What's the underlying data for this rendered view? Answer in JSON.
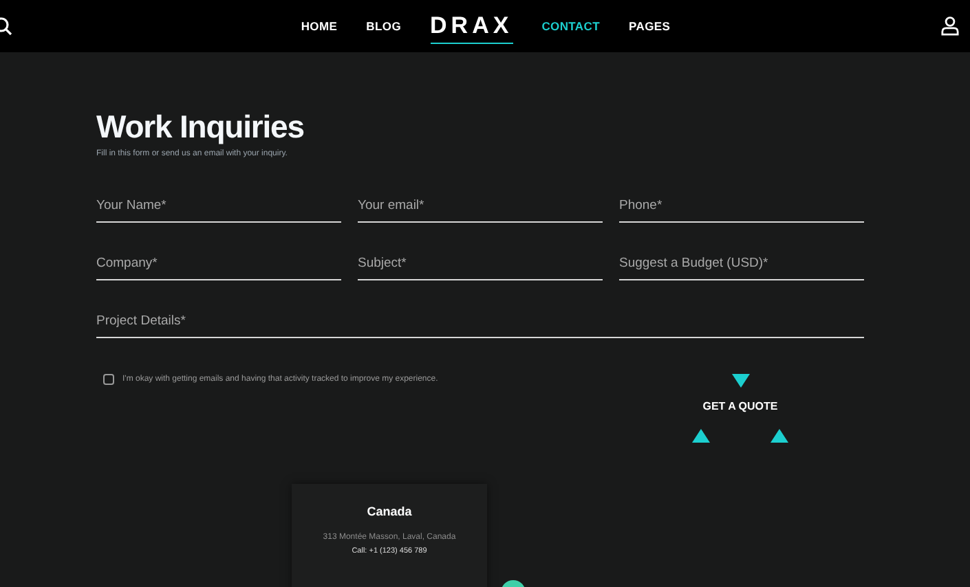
{
  "nav": {
    "left_items": [
      {
        "label": "HOME",
        "selected": false
      },
      {
        "label": "BLOG",
        "selected": false
      }
    ],
    "logo": "DRAX",
    "right_items": [
      {
        "label": "CONTACT",
        "selected": true
      },
      {
        "label": "PAGES",
        "selected": false
      }
    ]
  },
  "heading": "Work Inquiries",
  "subtitle": "Fill in this form or send us an email with your inquiry.",
  "fields": [
    {
      "placeholder": "Your Name*"
    },
    {
      "placeholder": "Your email*"
    },
    {
      "placeholder": "Phone*"
    },
    {
      "placeholder": "Company*"
    },
    {
      "placeholder": "Subject*"
    },
    {
      "placeholder": "Suggest a Budget (USD)*"
    }
  ],
  "details": {
    "placeholder": "Project Details*"
  },
  "consent": {
    "label": "I'm okay with getting emails and having that activity tracked to improve my experience.",
    "checked": false
  },
  "submit": "GET A QUOTE",
  "office": {
    "country": "Canada",
    "address": "313 Montée Masson, Laval, Canada",
    "phone": "Call: +1 (123) 456 789"
  }
}
